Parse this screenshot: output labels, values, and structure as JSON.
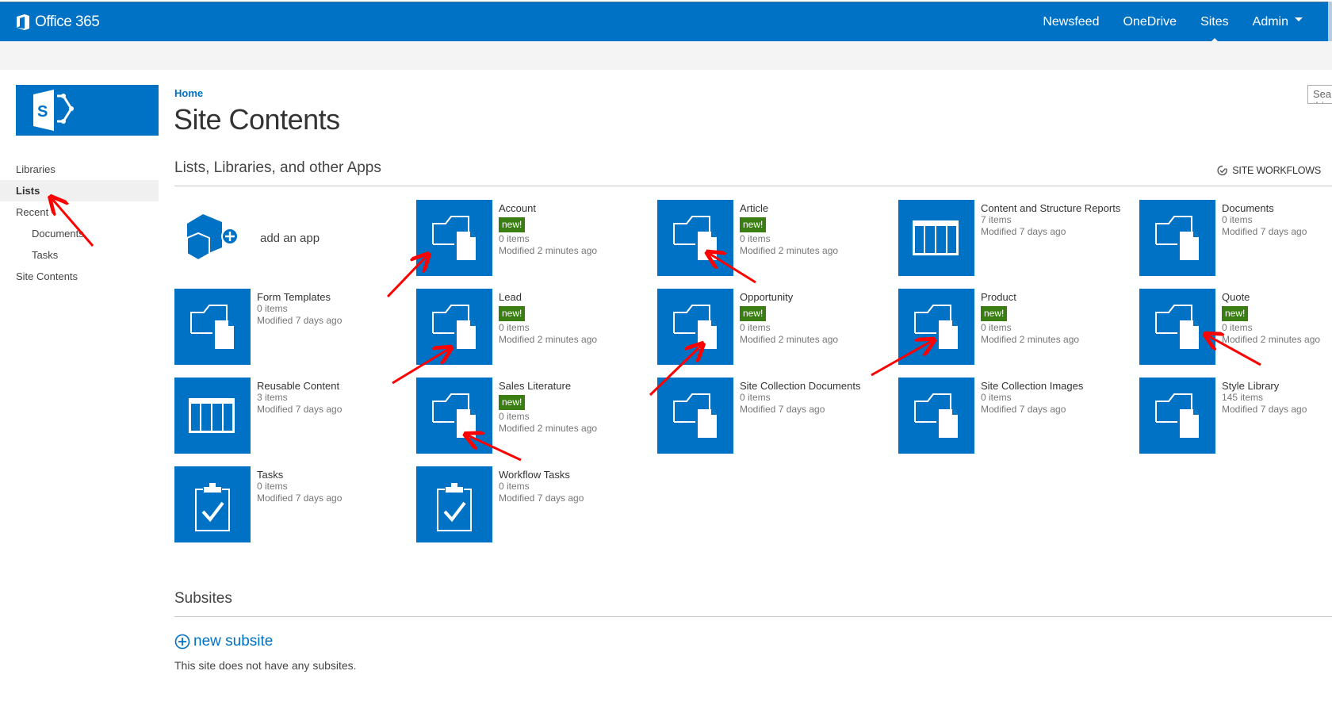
{
  "topbar": {
    "brand": "Office 365",
    "nav": [
      {
        "label": "Newsfeed",
        "active": false
      },
      {
        "label": "OneDrive",
        "active": false
      },
      {
        "label": "Sites",
        "active": true
      },
      {
        "label": "Admin",
        "active": false,
        "dropdown": true
      }
    ]
  },
  "search": {
    "placeholder": "Search this site"
  },
  "leftnav": {
    "items": [
      {
        "label": "Libraries"
      },
      {
        "label": "Lists",
        "selected": true
      },
      {
        "label": "Recent"
      },
      {
        "label": "Documents",
        "sub": true
      },
      {
        "label": "Tasks",
        "sub": true
      },
      {
        "label": "Site Contents"
      }
    ]
  },
  "breadcrumb": "Home",
  "page_title": "Site Contents",
  "apps_section": {
    "title": "Lists, Libraries, and other Apps",
    "site_workflows": "SITE WORKFLOWS",
    "add_app": "add an app"
  },
  "tiles": [
    {
      "title": "Account",
      "badge": "new!",
      "items": "0 items",
      "modified": "Modified 2 minutes ago",
      "icon": "folder-document-icon"
    },
    {
      "title": "Article",
      "badge": "new!",
      "items": "0 items",
      "modified": "Modified 2 minutes ago",
      "icon": "folder-document-icon"
    },
    {
      "title": "Content and Structure Reports",
      "badge": null,
      "items": "7 items",
      "modified": "Modified 7 days ago",
      "icon": "list-table-icon"
    },
    {
      "title": "Documents",
      "badge": null,
      "items": "0 items",
      "modified": "Modified 7 days ago",
      "icon": "folder-document-icon"
    },
    {
      "title": "Form Templates",
      "badge": null,
      "items": "0 items",
      "modified": "Modified 7 days ago",
      "icon": "folder-document-icon"
    },
    {
      "title": "Lead",
      "badge": "new!",
      "items": "0 items",
      "modified": "Modified 2 minutes ago",
      "icon": "folder-document-icon"
    },
    {
      "title": "Opportunity",
      "badge": "new!",
      "items": "0 items",
      "modified": "Modified 2 minutes ago",
      "icon": "folder-document-icon"
    },
    {
      "title": "Product",
      "badge": "new!",
      "items": "0 items",
      "modified": "Modified 2 minutes ago",
      "icon": "folder-document-icon"
    },
    {
      "title": "Quote",
      "badge": "new!",
      "items": "0 items",
      "modified": "Modified 2 minutes ago",
      "icon": "folder-document-icon"
    },
    {
      "title": "Reusable Content",
      "badge": null,
      "items": "3 items",
      "modified": "Modified 7 days ago",
      "icon": "list-table-icon"
    },
    {
      "title": "Sales Literature",
      "badge": "new!",
      "items": "0 items",
      "modified": "Modified 2 minutes ago",
      "icon": "folder-document-icon"
    },
    {
      "title": "Site Collection Documents",
      "badge": null,
      "items": "0 items",
      "modified": "Modified 7 days ago",
      "icon": "folder-document-icon"
    },
    {
      "title": "Site Collection Images",
      "badge": null,
      "items": "0 items",
      "modified": "Modified 7 days ago",
      "icon": "folder-document-icon"
    },
    {
      "title": "Style Library",
      "badge": null,
      "items": "145 items",
      "modified": "Modified 7 days ago",
      "icon": "folder-document-icon"
    },
    {
      "title": "Tasks",
      "badge": null,
      "items": "0 items",
      "modified": "Modified 7 days ago",
      "icon": "tasks-clipboard-icon"
    },
    {
      "title": "Workflow Tasks",
      "badge": null,
      "items": "0 items",
      "modified": "Modified 7 days ago",
      "icon": "tasks-clipboard-icon"
    }
  ],
  "subsites": {
    "title": "Subsites",
    "new_subsite": "new subsite",
    "empty_message": "This site does not have any subsites."
  },
  "colors": {
    "brand_blue": "#0072c6",
    "badge_green": "#3a7d12",
    "annotation_red": "#ff0000"
  }
}
